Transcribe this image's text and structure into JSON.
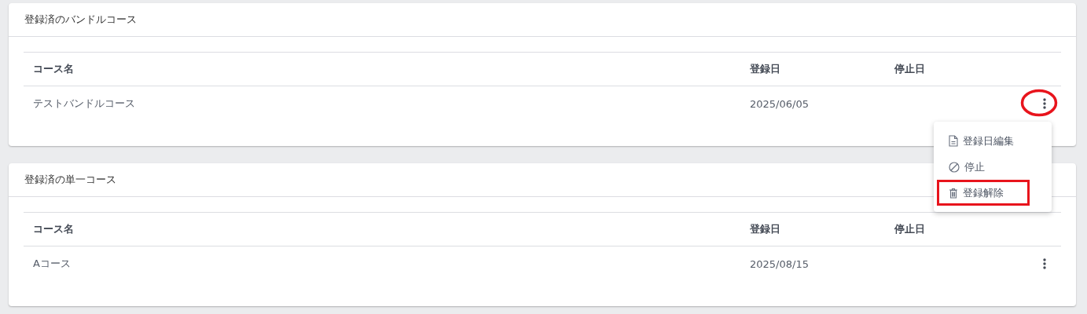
{
  "sections": [
    {
      "title": "登録済のバンドルコース",
      "columns": [
        "コース名",
        "登録日",
        "停止日"
      ],
      "rows": [
        {
          "name": "テストバンドルコース",
          "registered": "2025/06/05",
          "circled": true,
          "menu_open": true,
          "menu": [
            {
              "kind": "edit",
              "label": "登録日編集",
              "highlighted": false
            },
            {
              "kind": "stop",
              "label": "停止",
              "highlighted": false
            },
            {
              "kind": "delete",
              "label": "登録解除",
              "highlighted": true
            }
          ]
        }
      ]
    },
    {
      "title": "登録済の単一コース",
      "columns": [
        "コース名",
        "登録日",
        "停止日"
      ],
      "rows": [
        {
          "name": "Aコース",
          "registered": "2025/08/15"
        }
      ]
    }
  ]
}
